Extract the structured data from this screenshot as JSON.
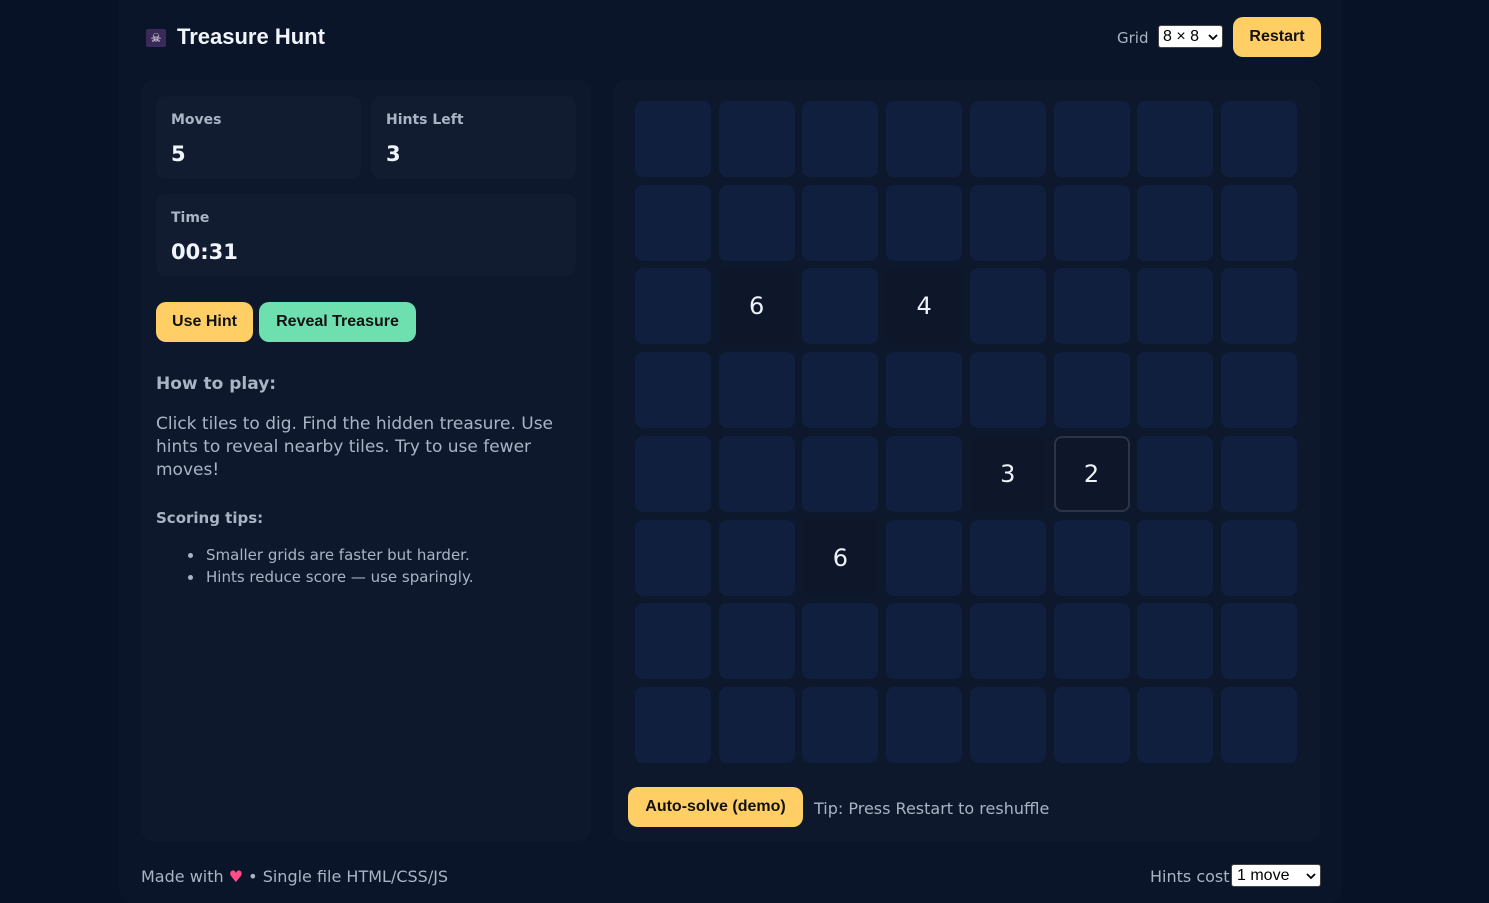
{
  "header": {
    "logo_icon": "skull-flag-icon",
    "title": "Treasure Hunt",
    "grid_label": "Grid",
    "grid_size": "8 × 8",
    "restart_label": "Restart"
  },
  "stats": {
    "moves_label": "Moves",
    "moves": "5",
    "hints_label": "Hints Left",
    "hints": "3",
    "time_label": "Time",
    "time": "00:31"
  },
  "actions": {
    "use_hint": "Use Hint",
    "reveal": "Reveal Treasure"
  },
  "howto": {
    "title": "How to play:",
    "text": "Click tiles to dig. Find the hidden treasure. Use hints to reveal nearby tiles. Try to use fewer moves!"
  },
  "tips": {
    "title": "Scoring tips:",
    "items": [
      "Smaller grids are faster but harder.",
      "Hints reduce score — use sparingly."
    ]
  },
  "board": {
    "rows": 8,
    "cols": 8,
    "revealed": [
      {
        "row": 3,
        "col": 2,
        "value": "6"
      },
      {
        "row": 3,
        "col": 4,
        "value": "4"
      },
      {
        "row": 5,
        "col": 5,
        "value": "3"
      },
      {
        "row": 5,
        "col": 6,
        "value": "2",
        "selected": true
      },
      {
        "row": 6,
        "col": 3,
        "value": "6"
      }
    ]
  },
  "bottom": {
    "autosolve": "Auto-solve (demo)",
    "tip": "Tip: Press Restart to reshuffle"
  },
  "footer": {
    "made_with": "Made with",
    "heart_icon": "heart-icon",
    "rest": "• Single file HTML/CSS/JS",
    "hints_cost_label": "Hints cost",
    "hints_cost": "1 move"
  },
  "colors": {
    "accent_yellow": "#ffcf66",
    "accent_green": "#6ee0b0",
    "tile": "#0f1f3d",
    "tile_dug": "#0e1729",
    "background": "#081226"
  }
}
